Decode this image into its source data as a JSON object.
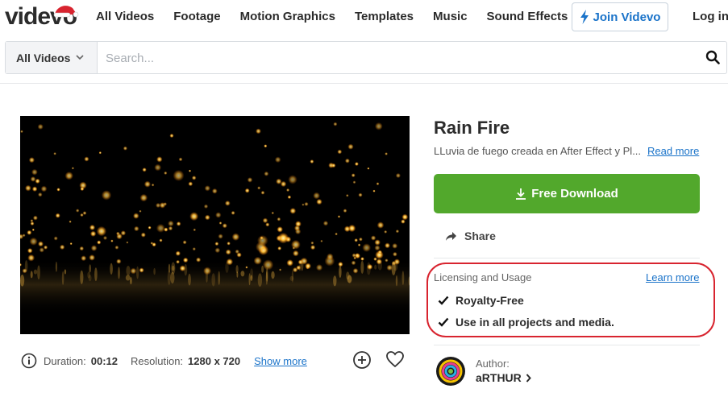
{
  "brand": {
    "logo": "videvo"
  },
  "nav": {
    "links": [
      "All Videos",
      "Footage",
      "Motion Graphics",
      "Templates",
      "Music",
      "Sound Effects"
    ],
    "join_label": "Join Videvo",
    "login_label": "Log in"
  },
  "search": {
    "category": "All Videos",
    "placeholder": "Search..."
  },
  "video": {
    "title": "Rain Fire",
    "description": "LLuvia de fuego creada en After Effect y Pl...",
    "read_more": "Read more",
    "duration_label": "Duration:",
    "duration": "00:12",
    "resolution_label": "Resolution:",
    "resolution": "1280 x 720",
    "show_more": "Show more"
  },
  "actions": {
    "download_label": "Free Download",
    "share_label": "Share"
  },
  "license": {
    "title": "Licensing and Usage",
    "learn_more": "Learn more",
    "items": [
      "Royalty-Free",
      "Use in all projects and media."
    ]
  },
  "author": {
    "label": "Author:",
    "name": "aRTHUR"
  },
  "colors": {
    "accent_green": "#52a82c",
    "link_blue": "#1a73c9",
    "annotation_red": "#d8242f"
  }
}
